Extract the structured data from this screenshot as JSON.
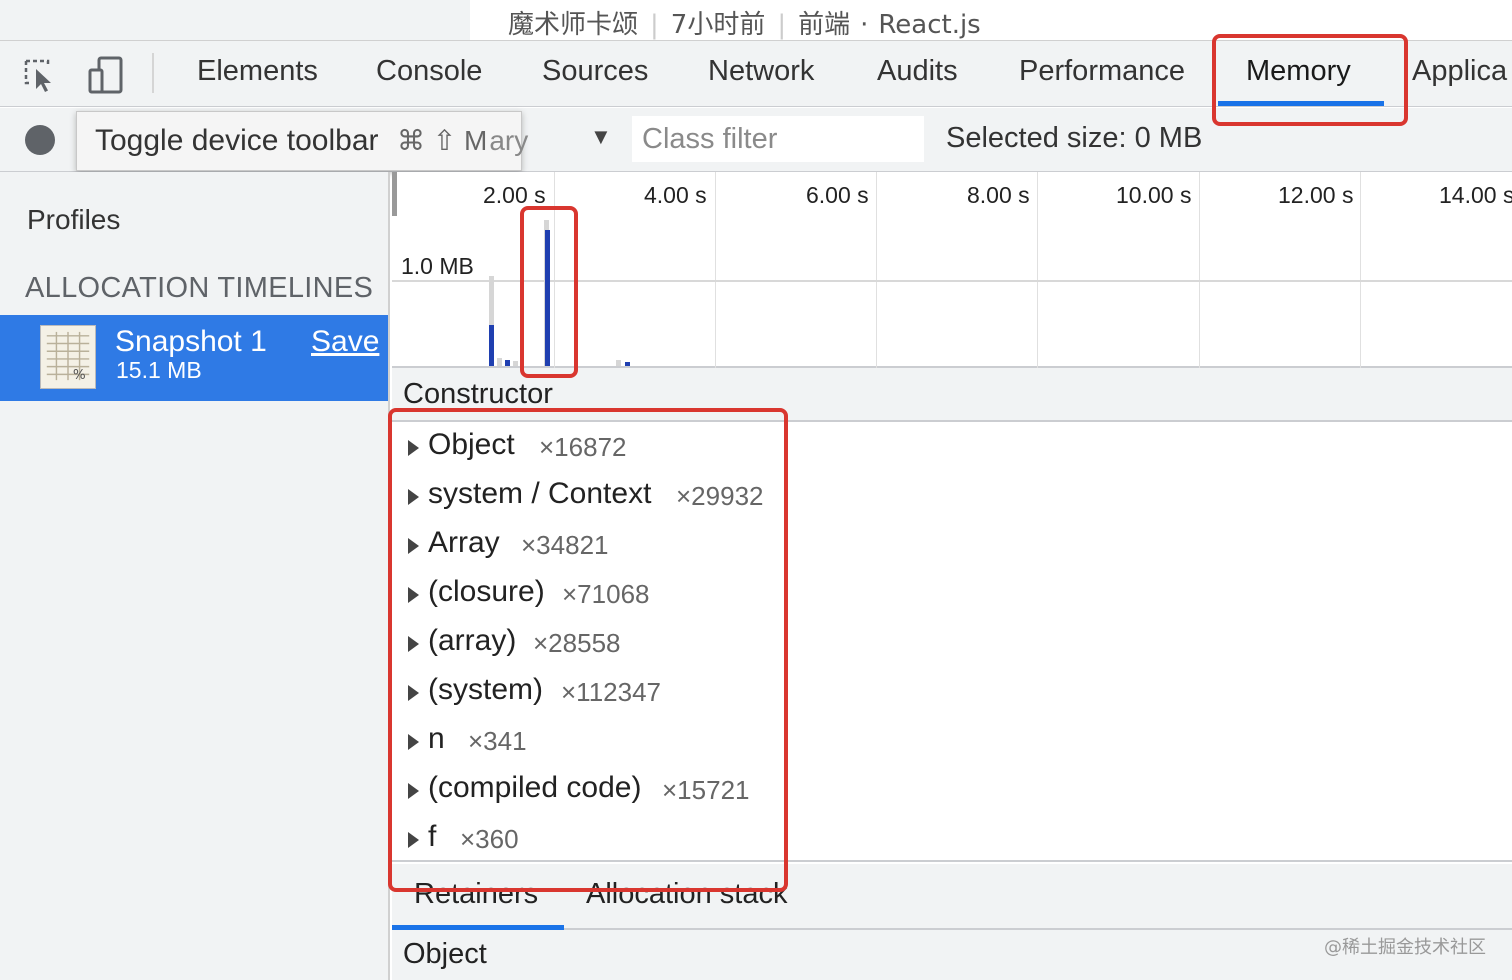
{
  "caption": {
    "author": "魔术师卡颂",
    "time": "7小时前",
    "category": "前端",
    "tag": "React.js"
  },
  "tabs": [
    {
      "label": "Elements"
    },
    {
      "label": "Console"
    },
    {
      "label": "Sources"
    },
    {
      "label": "Network"
    },
    {
      "label": "Audits"
    },
    {
      "label": "Performance"
    },
    {
      "label": "Memory"
    },
    {
      "label": "Applica"
    }
  ],
  "toolbar": {
    "tooltip_text": "Toggle device toolbar",
    "tooltip_shortcut": "⌘ ⇧ M",
    "summary_partial": "ary",
    "dropdown_arrow": "▼",
    "class_filter_placeholder": "Class filter",
    "selected_size": "Selected size: 0 MB"
  },
  "sidebar": {
    "profiles_title": "Profiles",
    "section_title": "ALLOCATION TIMELINES",
    "snapshot": {
      "name": "Snapshot 1",
      "size": "15.1 MB",
      "save_label": "Save"
    }
  },
  "timeline": {
    "tick_labels": [
      "2.00 s",
      "4.00 s",
      "6.00 s",
      "8.00 s",
      "10.00 s",
      "12.00 s",
      "14.00 s"
    ],
    "memory_label": "1.0 MB"
  },
  "constructor_header": "Constructor",
  "constructors": [
    {
      "name": "Object",
      "count": "×16872"
    },
    {
      "name": "system / Context",
      "count": "×29932"
    },
    {
      "name": "Array",
      "count": "×34821"
    },
    {
      "name": "(closure)",
      "count": "×71068"
    },
    {
      "name": "(array)",
      "count": "×28558"
    },
    {
      "name": "(system)",
      "count": "×112347"
    },
    {
      "name": "n",
      "count": "×341"
    },
    {
      "name": "(compiled code)",
      "count": "×15721"
    },
    {
      "name": "f",
      "count": "×360"
    }
  ],
  "bottom": {
    "tabs": [
      {
        "label": "Retainers"
      },
      {
        "label": "Allocation stack"
      }
    ],
    "object_label": "Object"
  },
  "watermark": "@稀土掘金技术社区",
  "colors": {
    "accent": "#1a73e8",
    "selection": "#2f7ae5",
    "highlight": "#d9362f",
    "bar_allocated": "#1f3fb0",
    "bar_freed": "#c8c8c8"
  }
}
